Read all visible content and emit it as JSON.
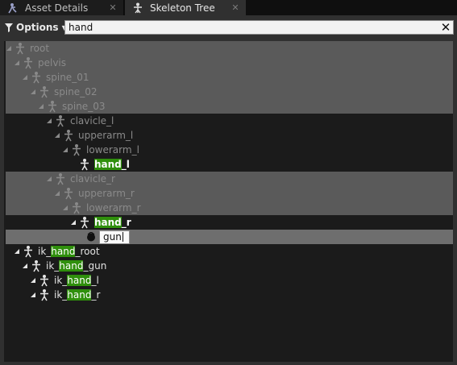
{
  "tabs": [
    {
      "label": "Asset Details",
      "icon": "asset-details-icon",
      "active": false
    },
    {
      "label": "Skeleton Tree",
      "icon": "skeleton-tree-icon",
      "active": true
    }
  ],
  "toolbar": {
    "options_label": "Options",
    "search_value": "hand"
  },
  "tree": {
    "rows": [
      {
        "name": "root",
        "depth": 0,
        "style": "dim",
        "pre": "root",
        "match": "",
        "post": ""
      },
      {
        "name": "pelvis",
        "depth": 1,
        "style": "dim",
        "pre": "pelvis",
        "match": "",
        "post": ""
      },
      {
        "name": "spine_01",
        "depth": 2,
        "style": "dim",
        "pre": "spine_01",
        "match": "",
        "post": ""
      },
      {
        "name": "spine_02",
        "depth": 3,
        "style": "dim",
        "pre": "spine_02",
        "match": "",
        "post": ""
      },
      {
        "name": "spine_03",
        "depth": 4,
        "style": "dim",
        "pre": "spine_03",
        "match": "",
        "post": ""
      },
      {
        "name": "clavicle_l",
        "depth": 5,
        "style": "dim",
        "pre": "clavicle_l",
        "match": "",
        "post": ""
      },
      {
        "name": "upperarm_l",
        "depth": 6,
        "style": "dim",
        "pre": "upperarm_l",
        "match": "",
        "post": ""
      },
      {
        "name": "lowerarm_l",
        "depth": 7,
        "style": "dim",
        "pre": "lowerarm_l",
        "match": "",
        "post": ""
      },
      {
        "name": "hand_l",
        "depth": 8,
        "style": "bright",
        "pre": "",
        "match": "hand",
        "post": "_l"
      },
      {
        "name": "clavicle_r",
        "depth": 5,
        "style": "dim",
        "pre": "clavicle_r",
        "match": "",
        "post": ""
      },
      {
        "name": "upperarm_r",
        "depth": 6,
        "style": "dim",
        "pre": "upperarm_r",
        "match": "",
        "post": ""
      },
      {
        "name": "lowerarm_r",
        "depth": 7,
        "style": "dim",
        "pre": "lowerarm_r",
        "match": "",
        "post": ""
      },
      {
        "name": "hand_r",
        "depth": 8,
        "style": "bright",
        "pre": "",
        "match": "hand",
        "post": "_r"
      },
      {
        "name": "gun",
        "depth": 9,
        "style": "socket",
        "pre": "gun",
        "match": "",
        "post": ""
      },
      {
        "name": "ik_hand_root",
        "depth": 1,
        "style": "norm",
        "pre": "ik_",
        "match": "hand",
        "post": "_root"
      },
      {
        "name": "ik_hand_gun",
        "depth": 2,
        "style": "norm",
        "pre": "ik_",
        "match": "hand",
        "post": "_gun"
      },
      {
        "name": "ik_hand_l",
        "depth": 3,
        "style": "norm",
        "pre": "ik_",
        "match": "hand",
        "post": "_l"
      },
      {
        "name": "ik_hand_r",
        "depth": 3,
        "style": "norm",
        "pre": "ik_",
        "match": "hand",
        "post": "_r"
      }
    ]
  },
  "colors": {
    "match_highlight": "#2f8f0c",
    "panel_bg": "#303030",
    "tree_bg": "#1b1b1b",
    "ancestor_band": "#5a5a5a",
    "selected_row": "#6e6e6e"
  },
  "icons": {
    "bone": "bone-icon",
    "socket": "socket-icon",
    "filter": "filter-icon",
    "clear": "close-icon"
  }
}
